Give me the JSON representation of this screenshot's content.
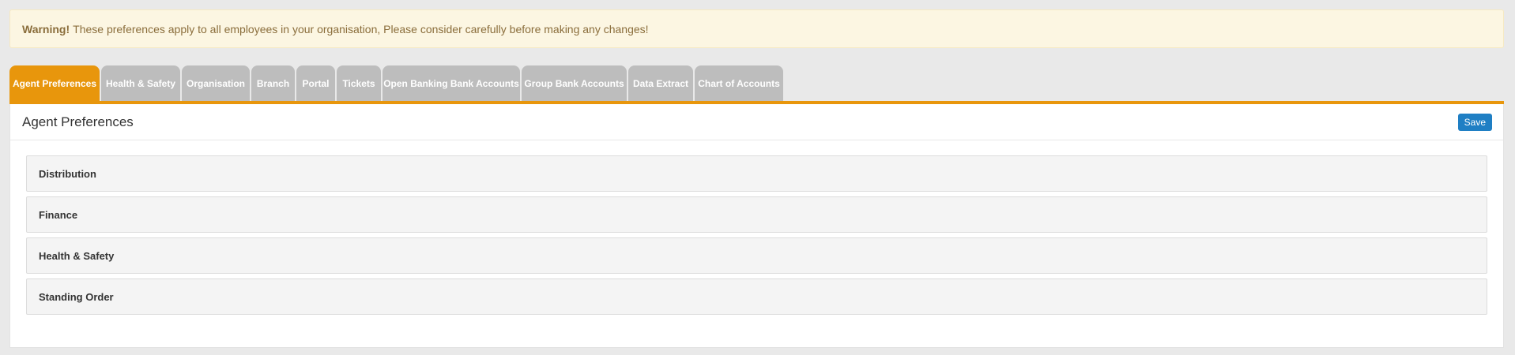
{
  "warning": {
    "label": "Warning!",
    "message": "These preferences apply to all employees in your organisation, Please consider carefully before making any changes!"
  },
  "tabs": [
    {
      "label": "Agent Preferences",
      "active": true
    },
    {
      "label": "Health & Safety",
      "active": false
    },
    {
      "label": "Organisation",
      "active": false
    },
    {
      "label": "Branch",
      "active": false
    },
    {
      "label": "Portal",
      "active": false
    },
    {
      "label": "Tickets",
      "active": false
    },
    {
      "label": "Open Banking Bank Accounts",
      "active": false
    },
    {
      "label": "Group Bank Accounts",
      "active": false
    },
    {
      "label": "Data Extract",
      "active": false
    },
    {
      "label": "Chart of Accounts",
      "active": false
    }
  ],
  "panel": {
    "title": "Agent Preferences",
    "save_label": "Save",
    "sections": [
      {
        "label": "Distribution"
      },
      {
        "label": "Finance"
      },
      {
        "label": "Health & Safety"
      },
      {
        "label": "Standing Order"
      }
    ]
  },
  "colors": {
    "accent": "#e8960c",
    "tab_inactive": "#bdbdbd",
    "save_button": "#1f7fc4",
    "warning_bg": "#fcf6e2"
  }
}
